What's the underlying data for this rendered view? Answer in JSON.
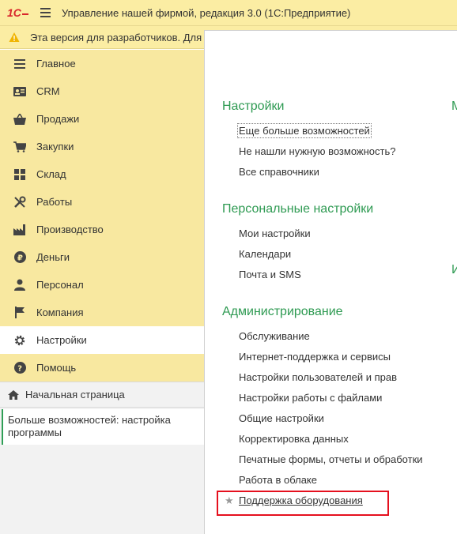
{
  "app": {
    "title": "Управление нашей фирмой, редакция 3.0  (1С:Предприятие)"
  },
  "warning": {
    "text": "Эта версия для разработчиков. Для"
  },
  "sections": [
    {
      "label": "Главное",
      "icon": "list-icon"
    },
    {
      "label": "CRM",
      "icon": "contact-card-icon"
    },
    {
      "label": "Продажи",
      "icon": "basket-icon"
    },
    {
      "label": "Закупки",
      "icon": "cart-icon"
    },
    {
      "label": "Склад",
      "icon": "warehouse-grid-icon"
    },
    {
      "label": "Работы",
      "icon": "tools-icon"
    },
    {
      "label": "Производство",
      "icon": "factory-icon"
    },
    {
      "label": "Деньги",
      "icon": "ruble-icon"
    },
    {
      "label": "Персонал",
      "icon": "person-icon"
    },
    {
      "label": "Компания",
      "icon": "flag-icon"
    },
    {
      "label": "Настройки",
      "icon": "gear-icon",
      "active": true
    },
    {
      "label": "Помощь",
      "icon": "help-icon"
    }
  ],
  "home": {
    "label": "Начальная страница"
  },
  "open_window": {
    "label": "Больше возможностей: настройка программы"
  },
  "groups": {
    "settings": {
      "title": "Настройки",
      "links": [
        "Еще больше возможностей",
        "Не нашли нужную возможность?",
        "Все справочники"
      ]
    },
    "personal": {
      "title": "Персональные настройки",
      "links": [
        "Мои настройки",
        "Календари",
        "Почта и SMS"
      ]
    },
    "admin": {
      "title": "Администрирование",
      "links": [
        "Обслуживание",
        "Интернет-поддержка и сервисы",
        "Настройки пользователей и прав",
        "Настройки работы с файлами",
        "Общие настройки",
        "Корректировка данных",
        "Печатные формы, отчеты и обработки",
        "Работа в облаке",
        "Поддержка оборудования"
      ]
    }
  },
  "right_column_partial": [
    "М",
    "И"
  ],
  "colors": {
    "titlebar": "#fbeda3",
    "sections_bg": "#f8e8a0",
    "group_title": "#2e9a52",
    "highlight_border": "#e5101e"
  }
}
